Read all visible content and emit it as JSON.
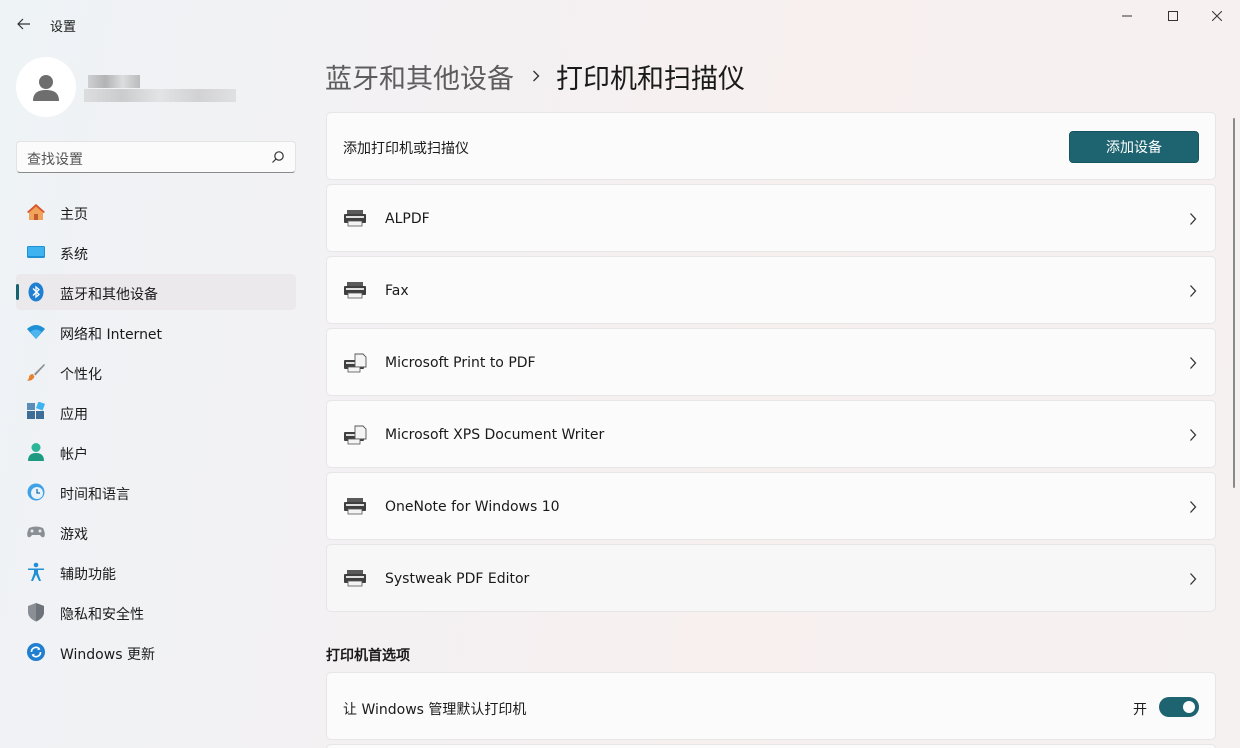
{
  "window": {
    "title": "设置"
  },
  "sidebar": {
    "search": {
      "placeholder": "查找设置"
    },
    "items": [
      {
        "label": "主页",
        "icon": "home-icon"
      },
      {
        "label": "系统",
        "icon": "system-icon"
      },
      {
        "label": "蓝牙和其他设备",
        "icon": "bluetooth-icon",
        "active": true
      },
      {
        "label": "网络和 Internet",
        "icon": "wifi-icon"
      },
      {
        "label": "个性化",
        "icon": "brush-icon"
      },
      {
        "label": "应用",
        "icon": "apps-icon"
      },
      {
        "label": "帐户",
        "icon": "account-icon"
      },
      {
        "label": "时间和语言",
        "icon": "time-language-icon"
      },
      {
        "label": "游戏",
        "icon": "gamepad-icon"
      },
      {
        "label": "辅助功能",
        "icon": "accessibility-icon"
      },
      {
        "label": "隐私和安全性",
        "icon": "shield-icon"
      },
      {
        "label": "Windows 更新",
        "icon": "update-icon"
      }
    ]
  },
  "breadcrumb": {
    "parent": "蓝牙和其他设备",
    "current": "打印机和扫描仪"
  },
  "add_card": {
    "label": "添加打印机或扫描仪",
    "button": "添加设备"
  },
  "printers": [
    {
      "name": "ALPDF",
      "icon": "printer-icon"
    },
    {
      "name": "Fax",
      "icon": "printer-icon"
    },
    {
      "name": "Microsoft Print to PDF",
      "icon": "printer-document-icon"
    },
    {
      "name": "Microsoft XPS Document Writer",
      "icon": "printer-document-icon"
    },
    {
      "name": "OneNote for Windows 10",
      "icon": "printer-icon"
    },
    {
      "name": "Systweak PDF Editor",
      "icon": "printer-icon"
    }
  ],
  "preferences": {
    "title": "打印机首选项",
    "manage_default": {
      "label": "让 Windows 管理默认打印机",
      "state": "开",
      "on": true
    }
  },
  "colors": {
    "accent": "#1d6470"
  }
}
